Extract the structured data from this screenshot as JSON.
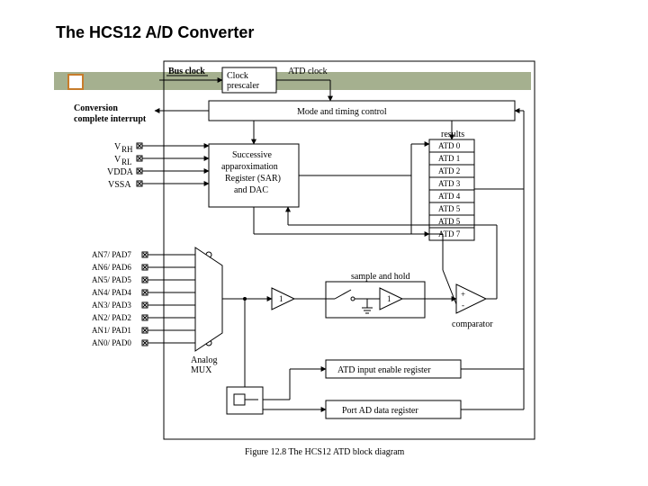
{
  "title": "The HCS12 A/D Converter",
  "caption": "Figure 12.8 The HCS12 ATD block diagram",
  "signals": {
    "bus_clock": "Bus clock",
    "atd_clock": "ATD clock",
    "interrupt_l1": "Conversion",
    "interrupt_l2": "complete interrupt",
    "vrh": "V",
    "vrh_sub": "RH",
    "vrl": "V",
    "vrl_sub": "RL",
    "vdda": "VDDA",
    "vssa": "VSSA"
  },
  "analog_pins": [
    "AN7/ PAD7",
    "AN6/ PAD6",
    "AN5/ PAD5",
    "AN4/ PAD4",
    "AN3/ PAD3",
    "AN2/ PAD2",
    "AN1/ PAD1",
    "AN0/ PAD0"
  ],
  "blocks": {
    "clock_prescaler_l1": "Clock",
    "clock_prescaler_l2": "prescaler",
    "mode_timing": "Mode and timing control",
    "sar_l1": "Successive",
    "sar_l2": "apparoximation",
    "sar_l3": "Register (SAR)",
    "sar_l4": "and DAC",
    "results_hdr": "results",
    "atd0": "ATD 0",
    "atd1": "ATD 1",
    "atd2": "ATD 2",
    "atd3": "ATD 3",
    "atd4": "ATD 4",
    "atd5": "ATD 5",
    "atd6": "ATD 5",
    "atd7": "ATD 7",
    "sample_hold": "sample and hold",
    "comparator": "comparator",
    "mux_l1": "Analog",
    "mux_l2": "MUX",
    "input_enable": "ATD input enable register",
    "port_ad": "Port AD data register"
  }
}
